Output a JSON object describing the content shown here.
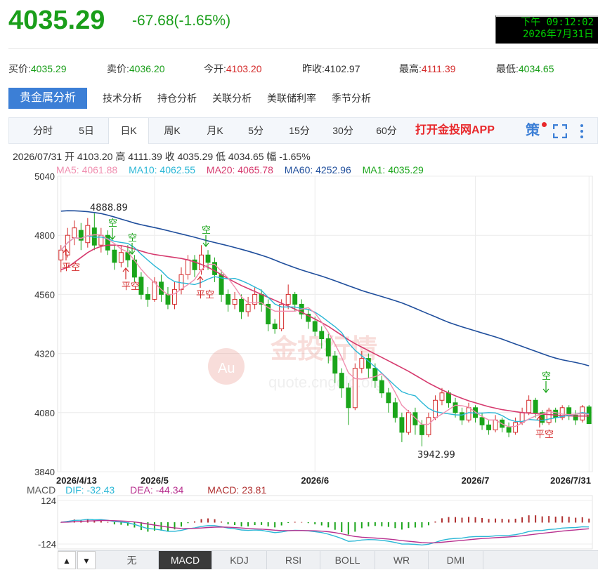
{
  "header": {
    "price": "4035.29",
    "change": "-67.68(-1.65%)",
    "clock_line1": "下午 09:12:02",
    "clock_line2": "2026年7月31日"
  },
  "quotes": [
    {
      "label": "买价:",
      "value": "4035.29",
      "color": "green"
    },
    {
      "label": "卖价:",
      "value": "4036.20",
      "color": "green"
    },
    {
      "label": "今开:",
      "value": "4103.20",
      "color": "red"
    },
    {
      "label": "昨收:",
      "value": "4102.97",
      "color": "dark"
    },
    {
      "label": "最高:",
      "value": "4111.39",
      "color": "red"
    },
    {
      "label": "最低:",
      "value": "4034.65",
      "color": "green"
    }
  ],
  "tabs": [
    "贵金属分析",
    "技术分析",
    "持仓分析",
    "关联分析",
    "美联储利率",
    "季节分析"
  ],
  "periods": [
    "分时",
    "5日",
    "日K",
    "周K",
    "月K",
    "5分",
    "15分",
    "30分",
    "60分"
  ],
  "active_period": "日K",
  "app_link": "打开金投网APP",
  "tool_icons": [
    "策",
    "fullscreen-icon",
    "more-icon"
  ],
  "ohlc": "2026/07/31  开 4103.20  高 4111.39  收 4035.29  低 4034.65  幅 -1.65%",
  "ma_legend": [
    {
      "text": "MA5: 4061.88",
      "color": "#f08fb0"
    },
    {
      "text": "MA10: 4062.55",
      "color": "#2bb7d6"
    },
    {
      "text": "MA20: 4065.78",
      "color": "#d63a6e"
    },
    {
      "text": "MA60: 4252.96",
      "color": "#1f4e9c"
    },
    {
      "text": "MA1: 4035.29",
      "color": "#1aa51a"
    }
  ],
  "watermark": {
    "main": "金投行情",
    "sub": "quote.cngold.org"
  },
  "macd_legend": [
    {
      "text": "MACD",
      "color": "#555"
    },
    {
      "text": "DIF: -32.43",
      "color": "#2bb7d6"
    },
    {
      "text": "DEA: -44.34",
      "color": "#b8308f"
    },
    {
      "text": "MACD: 23.81",
      "color": "#b03030"
    }
  ],
  "indicators": [
    "无",
    "MACD",
    "KDJ",
    "RSI",
    "BOLL",
    "WR",
    "DMI"
  ],
  "active_indicator": "MACD",
  "annotations": {
    "high_label": "4888.89",
    "low_label": "3942.99",
    "kong": "空",
    "pingkong": "平空"
  },
  "chart_data": {
    "type": "candlestick",
    "y_ticks": [
      5040,
      4800,
      4560,
      4320,
      4080,
      3840
    ],
    "ylim": [
      3840,
      5040
    ],
    "x_tick_labels": [
      "2026/4/13",
      "2026/5",
      "2026/6",
      "2026/7",
      "2026/7/31"
    ],
    "x_tick_index": [
      0,
      14,
      38,
      62,
      79
    ],
    "candles": [
      [
        4700,
        4740,
        4650,
        4760
      ],
      [
        4720,
        4800,
        4710,
        4830
      ],
      [
        4790,
        4830,
        4760,
        4860
      ],
      [
        4820,
        4780,
        4740,
        4850
      ],
      [
        4770,
        4840,
        4750,
        4870
      ],
      [
        4830,
        4760,
        4740,
        4889
      ],
      [
        4760,
        4800,
        4730,
        4830
      ],
      [
        4800,
        4740,
        4720,
        4820
      ],
      [
        4740,
        4690,
        4660,
        4760
      ],
      [
        4690,
        4730,
        4670,
        4760
      ],
      [
        4730,
        4700,
        4670,
        4760
      ],
      [
        4700,
        4630,
        4610,
        4720
      ],
      [
        4630,
        4560,
        4540,
        4650
      ],
      [
        4560,
        4540,
        4510,
        4590
      ],
      [
        4540,
        4610,
        4530,
        4630
      ],
      [
        4610,
        4560,
        4530,
        4640
      ],
      [
        4560,
        4520,
        4500,
        4590
      ],
      [
        4520,
        4580,
        4500,
        4610
      ],
      [
        4580,
        4640,
        4560,
        4670
      ],
      [
        4640,
        4700,
        4620,
        4720
      ],
      [
        4700,
        4660,
        4630,
        4720
      ],
      [
        4660,
        4720,
        4640,
        4760
      ],
      [
        4720,
        4690,
        4660,
        4740
      ],
      [
        4690,
        4640,
        4610,
        4710
      ],
      [
        4640,
        4560,
        4530,
        4660
      ],
      [
        4560,
        4520,
        4490,
        4580
      ],
      [
        4520,
        4540,
        4500,
        4570
      ],
      [
        4540,
        4490,
        4460,
        4560
      ],
      [
        4490,
        4520,
        4470,
        4550
      ],
      [
        4520,
        4560,
        4500,
        4590
      ],
      [
        4560,
        4520,
        4490,
        4580
      ],
      [
        4520,
        4440,
        4410,
        4540
      ],
      [
        4440,
        4420,
        4400,
        4460
      ],
      [
        4420,
        4520,
        4410,
        4540
      ],
      [
        4520,
        4560,
        4500,
        4600
      ],
      [
        4560,
        4520,
        4490,
        4570
      ],
      [
        4520,
        4480,
        4460,
        4540
      ],
      [
        4480,
        4450,
        4420,
        4500
      ],
      [
        4450,
        4410,
        4390,
        4470
      ],
      [
        4410,
        4380,
        4340,
        4430
      ],
      [
        4380,
        4310,
        4280,
        4400
      ],
      [
        4310,
        4240,
        4200,
        4330
      ],
      [
        4240,
        4180,
        4140,
        4260
      ],
      [
        4180,
        4100,
        4030,
        4200
      ],
      [
        4100,
        4260,
        4090,
        4280
      ],
      [
        4260,
        4300,
        4240,
        4330
      ],
      [
        4300,
        4260,
        4220,
        4320
      ],
      [
        4260,
        4210,
        4180,
        4280
      ],
      [
        4210,
        4160,
        4140,
        4230
      ],
      [
        4160,
        4120,
        4080,
        4180
      ],
      [
        4120,
        4060,
        4040,
        4140
      ],
      [
        4060,
        4000,
        3960,
        4080
      ],
      [
        4000,
        4080,
        3990,
        4090
      ],
      [
        4080,
        4030,
        3990,
        4100
      ],
      [
        4030,
        3990,
        3943,
        4050
      ],
      [
        3990,
        4060,
        3980,
        4080
      ],
      [
        4060,
        4130,
        4050,
        4150
      ],
      [
        4130,
        4160,
        4110,
        4180
      ],
      [
        4160,
        4120,
        4100,
        4170
      ],
      [
        4120,
        4080,
        4060,
        4140
      ],
      [
        4080,
        4050,
        4030,
        4100
      ],
      [
        4050,
        4100,
        4040,
        4120
      ],
      [
        4100,
        4060,
        4040,
        4110
      ],
      [
        4060,
        4030,
        4010,
        4080
      ],
      [
        4030,
        4010,
        3990,
        4050
      ],
      [
        4010,
        4050,
        4000,
        4070
      ],
      [
        4050,
        4020,
        4000,
        4060
      ],
      [
        4020,
        4000,
        3980,
        4040
      ],
      [
        4000,
        4040,
        3990,
        4060
      ],
      [
        4040,
        4080,
        4030,
        4100
      ],
      [
        4080,
        4130,
        4070,
        4150
      ],
      [
        4130,
        4080,
        4060,
        4140
      ],
      [
        4080,
        4040,
        4030,
        4090
      ],
      [
        4040,
        4090,
        4030,
        4100
      ],
      [
        4090,
        4060,
        4040,
        4100
      ],
      [
        4060,
        4100,
        4050,
        4110
      ],
      [
        4100,
        4070,
        4050,
        4110
      ],
      [
        4070,
        4050,
        4030,
        4090
      ],
      [
        4050,
        4103,
        4040,
        4111
      ],
      [
        4103,
        4035,
        4034,
        4111
      ]
    ],
    "series": [
      {
        "name": "MA60",
        "color": "#1f4e9c",
        "values": [
          4898,
          4900,
          4899,
          4897,
          4893,
          4888,
          4880,
          4870,
          4860,
          4850,
          4842,
          4835,
          4828,
          4820,
          4812,
          4804,
          4796,
          4787,
          4778,
          4770,
          4762,
          4754,
          4745,
          4736,
          4726,
          4716,
          4704,
          4690,
          4678,
          4666,
          4655,
          4645,
          4635,
          4624,
          4612,
          4600,
          4588,
          4576,
          4566,
          4556,
          4546,
          4536,
          4525,
          4512,
          4498,
          4484,
          4470,
          4456,
          4443,
          4432,
          4422,
          4412,
          4402,
          4392,
          4382,
          4370,
          4358,
          4346,
          4334,
          4322,
          4310,
          4300,
          4292,
          4286,
          4279,
          4270
        ]
      },
      {
        "name": "MA20",
        "color": "#d63a6e",
        "values": [
          4660,
          4670,
          4690,
          4710,
          4730,
          4745,
          4755,
          4760,
          4760,
          4758,
          4752,
          4744,
          4736,
          4728,
          4722,
          4718,
          4714,
          4710,
          4706,
          4700,
          4692,
          4682,
          4670,
          4656,
          4640,
          4624,
          4610,
          4596,
          4584,
          4572,
          4560,
          4548,
          4536,
          4524,
          4512,
          4500,
          4488,
          4474,
          4460,
          4446,
          4430,
          4412,
          4394,
          4376,
          4360,
          4346,
          4332,
          4318,
          4304,
          4290,
          4276,
          4262,
          4248,
          4232,
          4216,
          4200,
          4186,
          4172,
          4160,
          4148,
          4138,
          4128,
          4120,
          4112,
          4104,
          4098,
          4092,
          4088,
          4084,
          4080,
          4078,
          4076,
          4074,
          4072,
          4070,
          4068,
          4067,
          4066,
          4066,
          4066
        ]
      }
    ]
  }
}
